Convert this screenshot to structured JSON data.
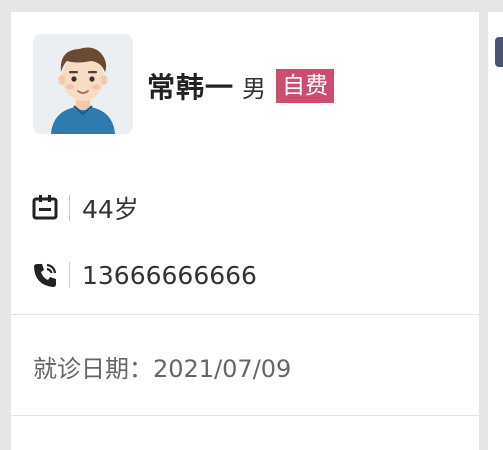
{
  "patient": {
    "name": "常韩一",
    "gender": "男",
    "payment_type": "自费",
    "age": "44岁",
    "phone": "13666666666"
  },
  "visit": {
    "label": "就诊日期：",
    "date": "2021/07/09"
  },
  "icons": {
    "avatar": "male-avatar-icon",
    "age": "calendar-icon",
    "phone": "phone-icon"
  },
  "colors": {
    "badge": "#cc4d6f",
    "avatar_shirt": "#2e7bb0",
    "background": "#e6e6e6"
  }
}
